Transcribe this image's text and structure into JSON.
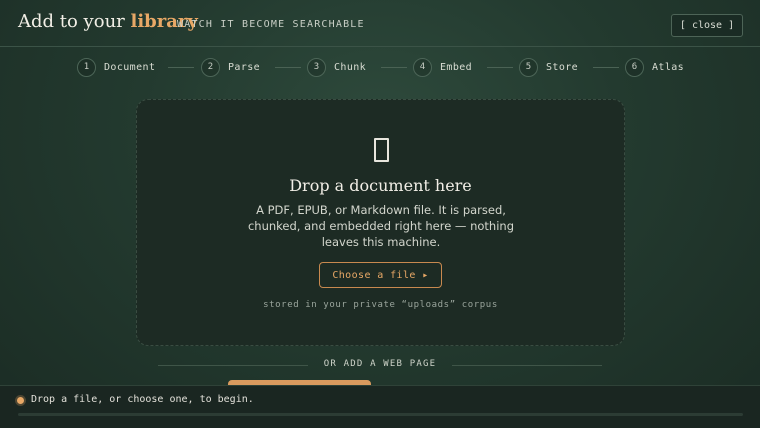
{
  "header": {
    "title_prefix": "Add to your ",
    "title_accent": "library",
    "subtitle": "WATCH IT BECOME SEARCHABLE",
    "close_label": "[ close ]"
  },
  "steps": [
    {
      "num": "1",
      "label": "Document"
    },
    {
      "num": "2",
      "label": "Parse"
    },
    {
      "num": "3",
      "label": "Chunk"
    },
    {
      "num": "4",
      "label": "Embed"
    },
    {
      "num": "5",
      "label": "Store"
    },
    {
      "num": "6",
      "label": "Atlas"
    }
  ],
  "dropzone": {
    "icon": "document-icon",
    "title": "Drop a document here",
    "description": "A PDF, EPUB, or Markdown file. It is parsed, chunked, and embedded right here — nothing leaves this machine.",
    "button_label": "Choose a file ▸",
    "note": "stored in your private “uploads” corpus"
  },
  "web": {
    "divider_label": "OR ADD A WEB PAGE"
  },
  "status": {
    "text": "Drop a file, or choose one, to begin.",
    "progress": 0
  },
  "colors": {
    "accent": "#e8a866",
    "background": "#233a2f",
    "panel": "#1d2b24"
  }
}
